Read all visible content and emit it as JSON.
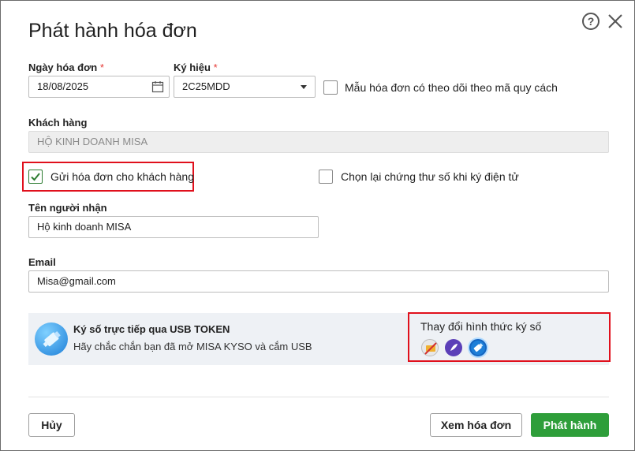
{
  "dialog": {
    "title": "Phát hành hóa đơn",
    "help_icon": "help-circle-icon",
    "close_icon": "close-icon"
  },
  "invoice_date": {
    "label": "Ngày hóa đơn",
    "required_mark": "*",
    "value": "18/08/2025",
    "icon": "calendar-icon"
  },
  "symbol": {
    "label": "Ký hiệu",
    "required_mark": "*",
    "value": "2C25MDD"
  },
  "track_by_code": {
    "label": "Mẫu hóa đơn có theo dõi theo mã quy cách",
    "checked": false
  },
  "customer": {
    "label": "Khách hàng",
    "value": "HỘ KINH DOANH MISA"
  },
  "send_to_customer": {
    "label": "Gửi hóa đơn cho khách hàng",
    "checked": true
  },
  "reselect_certificate": {
    "label": "Chọn lại chứng thư số khi ký điện tử",
    "checked": false
  },
  "recipient": {
    "label": "Tên người nhận",
    "value": "Hộ kinh doanh MISA"
  },
  "email": {
    "label": "Email",
    "value": "Misa@gmail.com"
  },
  "signing": {
    "title": "Ký số trực tiếp qua USB TOKEN",
    "subtitle": "Hãy chắc chắn bạn đã mở MISA KYSO và cắm USB",
    "change_label": "Thay đổi hình thức ký số",
    "methods": [
      "hsm-sign-icon",
      "remote-sign-icon",
      "usb-token-icon"
    ]
  },
  "footer": {
    "cancel_label": "Hủy",
    "preview_label": "Xem hóa đơn",
    "issue_label": "Phát hành"
  },
  "colors": {
    "primary": "#2e9e3a",
    "highlight": "#e0101c",
    "required": "#e53935"
  }
}
